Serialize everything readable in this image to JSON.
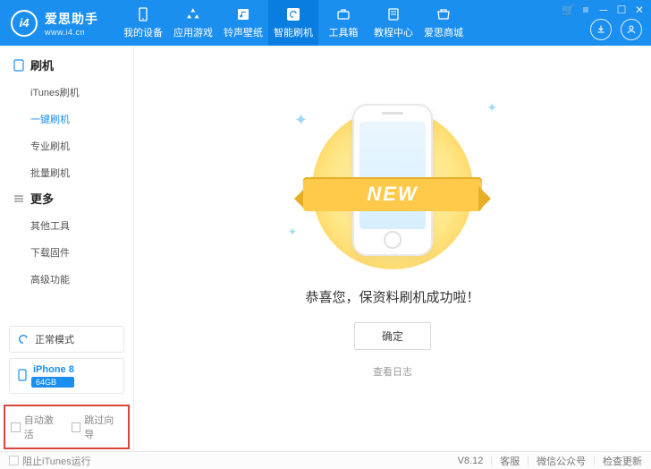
{
  "brand": {
    "name": "爱思助手",
    "url": "www.i4.cn",
    "logo": "i4"
  },
  "nav": [
    {
      "label": "我的设备",
      "icon": "phone"
    },
    {
      "label": "应用游戏",
      "icon": "apps"
    },
    {
      "label": "铃声壁纸",
      "icon": "music"
    },
    {
      "label": "智能刷机",
      "icon": "refresh",
      "active": true
    },
    {
      "label": "工具箱",
      "icon": "toolbox"
    },
    {
      "label": "教程中心",
      "icon": "book"
    },
    {
      "label": "爱思商城",
      "icon": "shop"
    }
  ],
  "sidebar": {
    "group1": {
      "title": "刷机",
      "items": [
        "iTunes刷机",
        "一键刷机",
        "专业刷机",
        "批量刷机"
      ],
      "active": 1
    },
    "group2": {
      "title": "更多",
      "items": [
        "其他工具",
        "下载固件",
        "高级功能"
      ]
    }
  },
  "status": {
    "mode": "正常模式",
    "device": "iPhone 8",
    "storage": "64GB"
  },
  "checks": {
    "auto_activate": "自动激活",
    "skip_guide": "跳过向导"
  },
  "main": {
    "banner": "NEW",
    "message": "恭喜您，保资料刷机成功啦！",
    "ok": "确定",
    "view_log": "查看日志"
  },
  "footer": {
    "block_itunes": "阻止iTunes运行",
    "version": "V8.12",
    "support": "客服",
    "wechat": "微信公众号",
    "update": "检查更新"
  }
}
